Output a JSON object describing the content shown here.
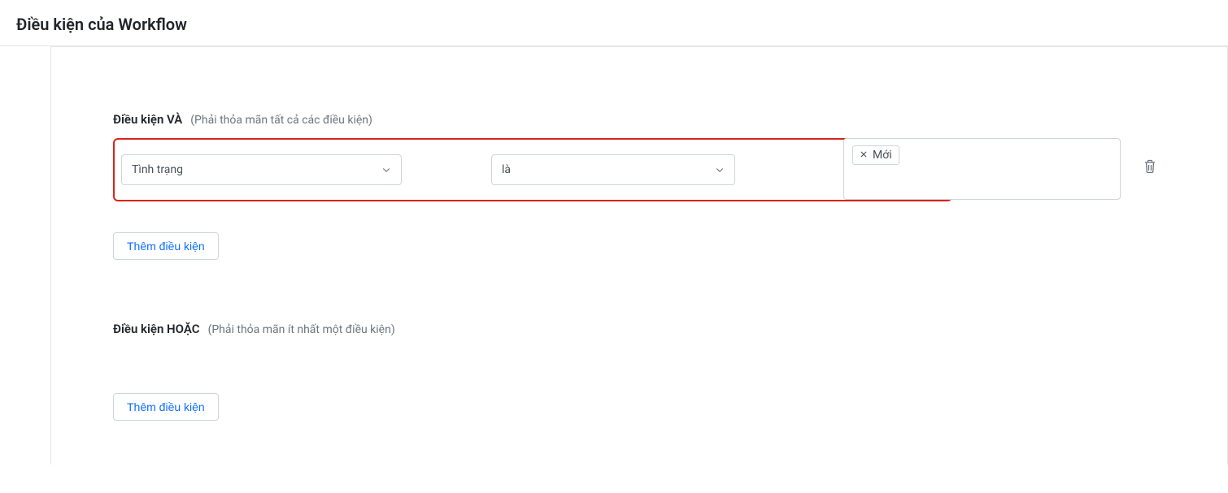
{
  "page": {
    "title": "Điều kiện của Workflow"
  },
  "sections": {
    "and": {
      "title": "Điều kiện VÀ",
      "subtitle": "(Phải thỏa mãn tất cả các điều kiện)",
      "conditions": [
        {
          "field": "Tình trạng",
          "operator": "là",
          "values": [
            "Mới"
          ]
        }
      ],
      "add_button_label": "Thêm điều kiện"
    },
    "or": {
      "title": "Điều kiện HOẶC",
      "subtitle": "(Phải thỏa mãn ít nhất một điều kiện)",
      "add_button_label": "Thêm điều kiện"
    }
  }
}
